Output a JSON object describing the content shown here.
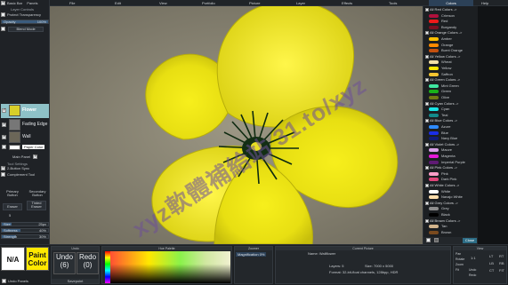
{
  "menu": [
    {
      "label": "File",
      "active": false
    },
    {
      "label": "Edit",
      "active": false
    },
    {
      "label": "View",
      "active": false
    },
    {
      "label": "Portfolio",
      "active": false
    },
    {
      "label": "Picture",
      "active": false
    },
    {
      "label": "Layer",
      "active": false
    },
    {
      "label": "Effects",
      "active": false
    },
    {
      "label": "Tools",
      "active": false
    },
    {
      "label": "Colors",
      "active": true
    },
    {
      "label": "Help",
      "active": false
    }
  ],
  "left_panel": {
    "basic_bar": "Basic Bar",
    "panels_label": "Panels",
    "layer_controls": "Layer Controls",
    "protect_transparency": "Protect Transparency",
    "opacity_label": "Opacity",
    "opacity_value": "100%",
    "opacity_fraction": 1.0,
    "blend_mode": "Blend Mode",
    "layers": [
      {
        "name": "Flower",
        "selected": true,
        "thumb": "#d8cf2a"
      },
      {
        "name": "Fading Edge",
        "selected": false,
        "thumb": "#777777"
      },
      {
        "name": "Wall",
        "selected": false,
        "thumb": "#6b6658"
      },
      {
        "name": "Paper Color",
        "selected": false,
        "thumb": "#ffffff"
      }
    ],
    "main_panel": "Main Panel",
    "tool_settings": "Tool Settings",
    "two_button_sync": "2-Button Sync",
    "complement_tool": "Complement Tool",
    "primary_button": "Primary Button",
    "secondary_button": "Secondary Button",
    "primary_tool": "Eraser",
    "secondary_tool": "Tinted Eraser",
    "sliders": [
      {
        "label": "Size",
        "value": "25px",
        "fraction": 0.22
      },
      {
        "label": "Softness",
        "value": "40%",
        "fraction": 0.4
      },
      {
        "label": "Strength",
        "value": "30%",
        "fraction": 0.3
      }
    ],
    "small_value": "5"
  },
  "colors_panel": {
    "title": "Colors",
    "close": "Close",
    "rows": [
      {
        "label": "All Red Colors ->",
        "header": true
      },
      {
        "label": "Crimson",
        "color": "#b0103c"
      },
      {
        "label": "Red",
        "color": "#ee1a1a"
      },
      {
        "label": "Burgandy",
        "color": "#7a1020"
      },
      {
        "label": "All Orange Colors ->",
        "header": true
      },
      {
        "label": "Amber",
        "color": "#ffbf00"
      },
      {
        "label": "Orange",
        "color": "#ff8a00"
      },
      {
        "label": "Burnt Orange",
        "color": "#c4500e"
      },
      {
        "label": "All Yellow Colors ->",
        "header": true
      },
      {
        "label": "Wheat",
        "color": "#f2dfa6"
      },
      {
        "label": "Yellow",
        "color": "#ffe800"
      },
      {
        "label": "Saffron",
        "color": "#f4c430"
      },
      {
        "label": "All Green Colors ->",
        "header": true
      },
      {
        "label": "Mint Green",
        "color": "#3fe6a0"
      },
      {
        "label": "Green",
        "color": "#19b219"
      },
      {
        "label": "Olive",
        "color": "#6f7a12"
      },
      {
        "label": "All Cyan Colors ->",
        "header": true
      },
      {
        "label": "Cyan",
        "color": "#19e5e5"
      },
      {
        "label": "Teal",
        "color": "#138a8a"
      },
      {
        "label": "All Blue Colors ->",
        "header": true
      },
      {
        "label": "Azure",
        "color": "#2e8bff"
      },
      {
        "label": "Blue",
        "color": "#1a2ee8"
      },
      {
        "label": "Navy Blue",
        "color": "#111c7a"
      },
      {
        "label": "All Violet Colors ->",
        "header": true
      },
      {
        "label": "Mauve",
        "color": "#d9a0e8"
      },
      {
        "label": "Magenta",
        "color": "#e619d9"
      },
      {
        "label": "Imperial Purple",
        "color": "#5e1a73"
      },
      {
        "label": "All Pink Colors ->",
        "header": true
      },
      {
        "label": "Pink",
        "color": "#ff9ec8"
      },
      {
        "label": "Dark Pink",
        "color": "#e0457a"
      },
      {
        "label": "All White Colors ->",
        "header": true
      },
      {
        "label": "White",
        "color": "#ffffff"
      },
      {
        "label": "Navajo White",
        "color": "#ffdead"
      },
      {
        "label": "All Grey Colors ->",
        "header": true
      },
      {
        "label": "Grey",
        "color": "#8c8c8c"
      },
      {
        "label": "Black",
        "color": "#000000"
      },
      {
        "label": "All Brown Colors ->",
        "header": true
      },
      {
        "label": "Tan",
        "color": "#d2b48c"
      },
      {
        "label": "Brown",
        "color": "#7a4a1e"
      }
    ]
  },
  "bottom": {
    "na_label": "N/A",
    "paint_color_label": "Paint Color",
    "paint_color": "#ffe800",
    "undo_label": "Undo",
    "undo_count": "(6)",
    "redo_label": "Redo",
    "redo_count": "(0)",
    "undo_section": "Undo",
    "saved_point": "Savepoint",
    "hue_palette": "Hue Palette",
    "zoomer_title": "Zoomer",
    "zoomer_mode": "Magnification",
    "zoomer_value": "0%",
    "current_picture_title": "Current Picture",
    "picture_name": "Name: Wallflower",
    "layers_info": "Layers: 5",
    "size_info": "Size: 7000 x 5000",
    "format_info": "Format: 32-bit-float channels, 128bpp, HDR",
    "view_title": "View",
    "view_labels": [
      "Pan",
      "Rotate",
      "Zoom",
      "Fit"
    ],
    "undo_ctrl": "Undo",
    "redo_ctrl": "Redo",
    "view_value": "1:1",
    "fit_labels": [
      "LT",
      "RT",
      "LB",
      "RB",
      "CT",
      "FIT"
    ],
    "undo_panels": "Undo Panels"
  },
  "watermark": "xyz軟體補給站 31.to/xyz"
}
